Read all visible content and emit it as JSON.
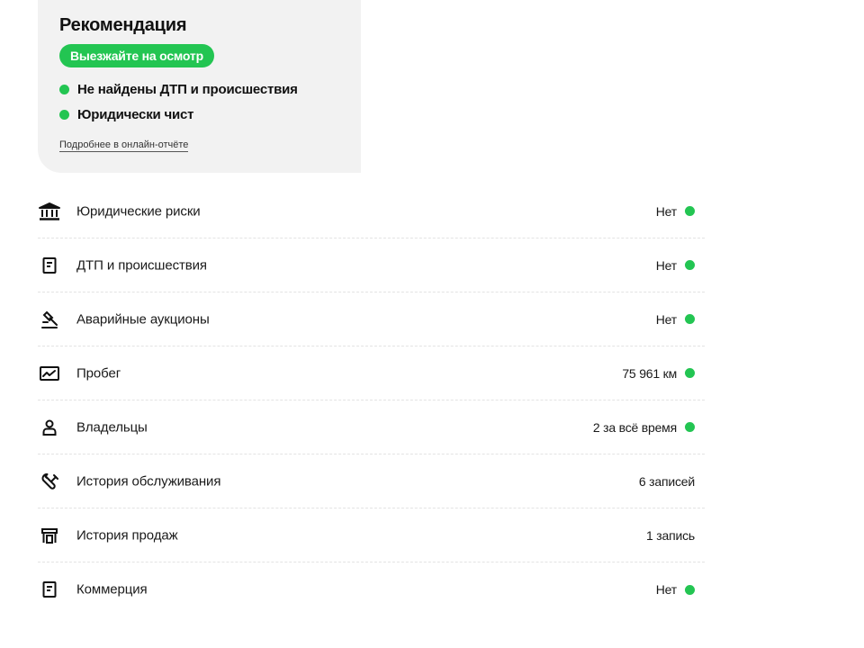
{
  "colors": {
    "accent_green": "#23c552",
    "card_bg": "#f2f2f2",
    "divider": "#e3e3e3"
  },
  "recommendation": {
    "title": "Рекомендация",
    "badge": "Выезжайте на осмотр",
    "points": [
      {
        "text": "Не найдены ДТП и происшествия",
        "status": "ok"
      },
      {
        "text": "Юридически чист",
        "status": "ok"
      }
    ],
    "link": "Подробнее в онлайн-отчёте"
  },
  "rows": [
    {
      "icon": "bank-icon",
      "label": "Юридические риски",
      "value": "Нет",
      "status": "ok"
    },
    {
      "icon": "document-icon",
      "label": "ДТП и происшествия",
      "value": "Нет",
      "status": "ok"
    },
    {
      "icon": "gavel-icon",
      "label": "Аварийные аукционы",
      "value": "Нет",
      "status": "ok"
    },
    {
      "icon": "chart-icon",
      "label": "Пробег",
      "value": "75 961 км",
      "status": "ok"
    },
    {
      "icon": "person-icon",
      "label": "Владельцы",
      "value": "2 за всё время",
      "status": "ok"
    },
    {
      "icon": "wrench-icon",
      "label": "История обслуживания",
      "value": "6 записей",
      "status": "none"
    },
    {
      "icon": "storefront-icon",
      "label": "История продаж",
      "value": "1 запись",
      "status": "none"
    },
    {
      "icon": "document-icon",
      "label": "Коммерция",
      "value": "Нет",
      "status": "ok"
    }
  ]
}
